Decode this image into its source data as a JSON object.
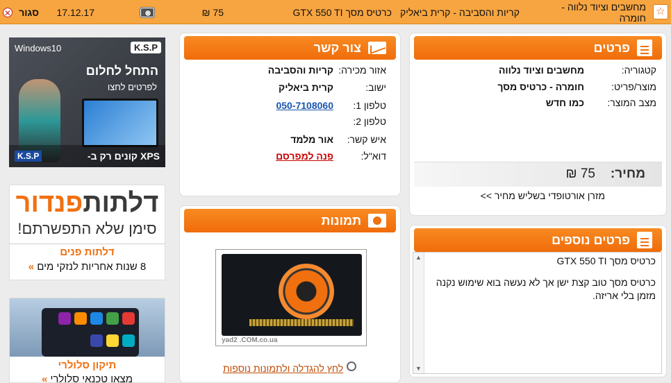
{
  "topbar": {
    "category": "מחשבים וציוד נלווה - חומרה",
    "location": "קריות והסביבה - קרית ביאליק",
    "title": "כרטיס מסך GTX 550 TI",
    "price": "75 ₪",
    "date": "17.12.17",
    "close_label": "סגור"
  },
  "details": {
    "header": "פרטים",
    "rows": [
      {
        "label": "קטגוריה:",
        "value": "מחשבים וציוד נלווה"
      },
      {
        "label": "מוצר/פריט:",
        "value": "חומרה - כרטיס מסך"
      },
      {
        "label": "מצב המוצר:",
        "value": "כמו חדש"
      }
    ],
    "price_label": "מחיר:",
    "price_value": "75 ₪",
    "stock_link": "מזרן אורטופדי בשליש מחיר >>"
  },
  "more_details": {
    "header": "פרטים נוספים",
    "title": "כרטיס מסך GTX 550 TI",
    "body": "כרטיס מסך טוב קצת ישן אך לא נעשה בוא שימוש נקנה מזמן בלי אריזה."
  },
  "contact": {
    "header": "צור קשר",
    "rows": [
      {
        "label": "אזור מכירה:",
        "value": "קריות והסביבה"
      },
      {
        "label": "ישוב:",
        "value": "קרית ביאליק"
      },
      {
        "label": "טלפון 1:",
        "value": "050-7108060"
      },
      {
        "label": "טלפון 2:",
        "value": ""
      },
      {
        "label": "איש קשר:",
        "value": "אור מלמד"
      },
      {
        "label": "דוא\"ל:",
        "value": "פנה למפרסם"
      }
    ]
  },
  "images": {
    "header": "תמונות",
    "enlarge_link": "לחץ להגדלה ולתמונות נוספות",
    "watermark": "yad2 .COM.co.ua"
  },
  "ads": {
    "ad1": {
      "brand": "Windows10",
      "ksp": "K.S.P",
      "headline": "התחל לחלום",
      "sub": "לפרטים לחצו",
      "footer": "XPS קונים רק ב-",
      "ksp2": "K.S.P"
    },
    "ad2": {
      "logo_a": "דלתות",
      "logo_b": "פנדור",
      "slogan": "סימן שלא התפשרתם!",
      "title": "דלתות פנים",
      "desc": "8 שנות אחריות לנזקי מים"
    },
    "ad3": {
      "title": "תיקון סלולרי",
      "desc": "מצאו טכנאי סלולרי"
    }
  },
  "colors": {
    "accent": "#f07010",
    "topbar": "#f7a540"
  }
}
